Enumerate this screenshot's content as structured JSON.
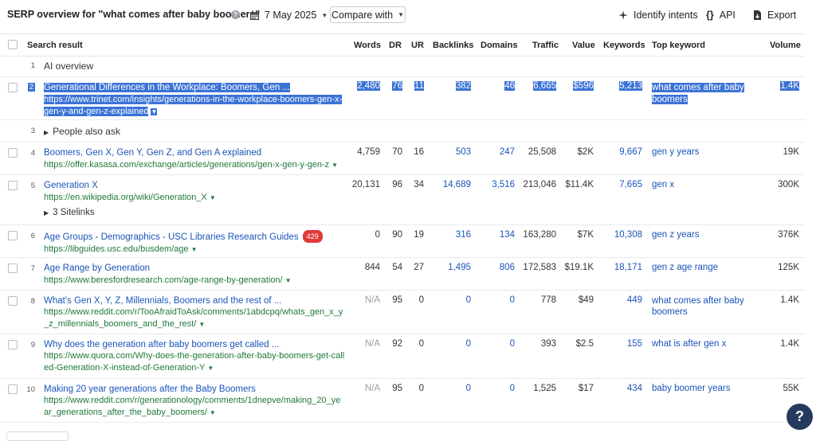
{
  "header": {
    "title": "SERP overview for \"what comes after baby boomers\"",
    "help_icon": "?",
    "date": "7 May 2025",
    "compare_label": "Compare with",
    "identify_label": "Identify intents",
    "api_label": "API",
    "api_icon": "{}",
    "export_label": "Export"
  },
  "columns": {
    "search_result": "Search result",
    "words": "Words",
    "dr": "DR",
    "ur": "UR",
    "backlinks": "Backlinks",
    "domains": "Domains",
    "traffic": "Traffic",
    "value": "Value",
    "keywords": "Keywords",
    "top_keyword": "Top keyword",
    "volume": "Volume"
  },
  "special_rows": {
    "ai_overview": {
      "idx": "1",
      "label": "AI overview"
    },
    "people_also_ask": {
      "idx": "3",
      "label": "People also ask"
    },
    "sitelinks": {
      "label": "3 Sitelinks"
    }
  },
  "rows": [
    {
      "idx": "2",
      "title": "Generational Differences in the Workplace: Boomers, Gen ...",
      "url_lines": [
        "https://www.trinet.com/insights/generations-in-the-workplace-boomers-gen-x-",
        "gen-y-and-gen-z-explained"
      ],
      "words": "2,480",
      "dr": "76",
      "ur": "11",
      "backlinks": "382",
      "domains": "46",
      "traffic": "6,665",
      "value": "$596",
      "keywords": "5,213",
      "top_keyword_lines": [
        "what comes after baby",
        "boomers"
      ],
      "volume": "1.4K",
      "selected": true
    },
    {
      "idx": "4",
      "title": "Boomers, Gen X, Gen Y, Gen Z, and Gen A explained",
      "url_lines": [
        "https://offer.kasasa.com/exchange/articles/generations/gen-x-gen-y-gen-z"
      ],
      "words": "4,759",
      "dr": "70",
      "ur": "16",
      "backlinks": "503",
      "domains": "247",
      "traffic": "25,508",
      "value": "$2K",
      "keywords": "9,667",
      "top_keyword_lines": [
        "gen y years"
      ],
      "volume": "19K"
    },
    {
      "idx": "5",
      "title": "Generation X",
      "url_lines": [
        "https://en.wikipedia.org/wiki/Generation_X"
      ],
      "words": "20,131",
      "dr": "96",
      "ur": "34",
      "backlinks": "14,689",
      "domains": "3,516",
      "traffic": "213,046",
      "value": "$11.4K",
      "keywords": "7,665",
      "top_keyword_lines": [
        "gen x"
      ],
      "volume": "300K"
    },
    {
      "idx": "6",
      "title": "Age Groups - Demographics - USC Libraries Research Guides",
      "badge": "429",
      "url_lines": [
        "https://libguides.usc.edu/busdem/age"
      ],
      "words": "0",
      "dr": "90",
      "ur": "19",
      "backlinks": "316",
      "domains": "134",
      "traffic": "163,280",
      "value": "$7K",
      "keywords": "10,308",
      "top_keyword_lines": [
        "gen z years"
      ],
      "volume": "376K"
    },
    {
      "idx": "7",
      "title": "Age Range by Generation",
      "url_lines": [
        "https://www.beresfordresearch.com/age-range-by-generation/"
      ],
      "words": "844",
      "dr": "54",
      "ur": "27",
      "backlinks": "1,495",
      "domains": "806",
      "traffic": "172,583",
      "value": "$19.1K",
      "keywords": "18,171",
      "top_keyword_lines": [
        "gen z age range"
      ],
      "volume": "125K"
    },
    {
      "idx": "8",
      "title": "What's Gen X, Y, Z, Millennials, Boomers and the rest of ...",
      "url_lines": [
        "https://www.reddit.com/r/TooAfraidToAsk/comments/1abdcpq/whats_gen_x_y",
        "_z_millennials_boomers_and_the_rest/"
      ],
      "words": "N/A",
      "dr": "95",
      "ur": "0",
      "backlinks": "0",
      "domains": "0",
      "traffic": "778",
      "value": "$49",
      "keywords": "449",
      "top_keyword_lines": [
        "what comes after baby",
        "boomers"
      ],
      "volume": "1.4K"
    },
    {
      "idx": "9",
      "title": "Why does the generation after baby boomers get called ...",
      "url_lines": [
        "https://www.quora.com/Why-does-the-generation-after-baby-boomers-get-call",
        "ed-Generation-X-instead-of-Generation-Y"
      ],
      "words": "N/A",
      "dr": "92",
      "ur": "0",
      "backlinks": "0",
      "domains": "0",
      "traffic": "393",
      "value": "$2.5",
      "keywords": "155",
      "top_keyword_lines": [
        "what is after gen x"
      ],
      "volume": "1.4K"
    },
    {
      "idx": "10",
      "title": "Making 20 year generations after the Baby Boomers",
      "url_lines": [
        "https://www.reddit.com/r/generationology/comments/1dnepve/making_20_ye",
        "ar_generations_after_the_baby_boomers/"
      ],
      "words": "N/A",
      "dr": "95",
      "ur": "0",
      "backlinks": "0",
      "domains": "0",
      "traffic": "1,525",
      "value": "$17",
      "keywords": "434",
      "top_keyword_lines": [
        "baby boomer years"
      ],
      "volume": "55K"
    }
  ],
  "fab": {
    "label": "?"
  },
  "colors": {
    "link_blue": "#1a54b8",
    "url_green": "#1f7a3a",
    "selection": "#3b73d6",
    "badge_red": "#e03a3a",
    "fab_navy": "#243b5e"
  }
}
